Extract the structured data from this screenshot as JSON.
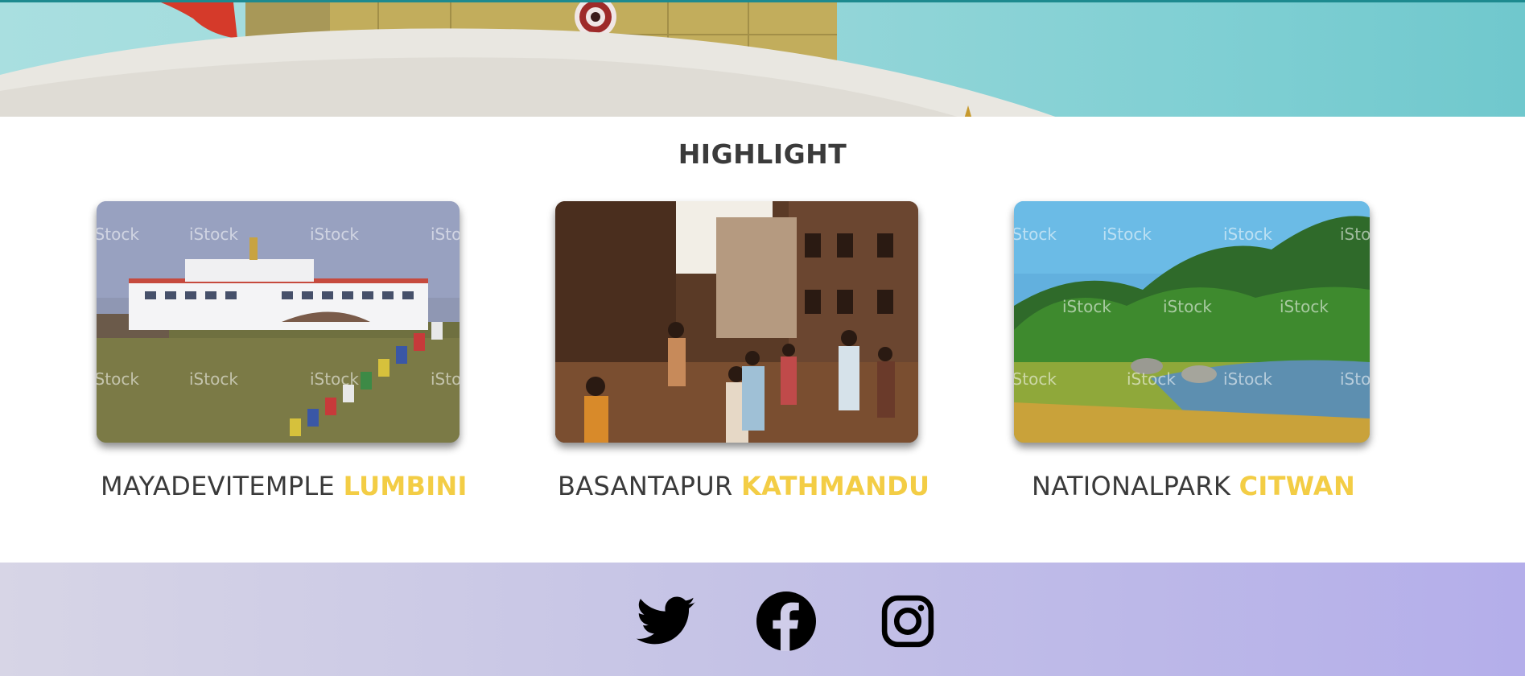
{
  "highlight": {
    "title": "HIGHLIGHT",
    "cards": [
      {
        "name": "MAYADEVITEMPLE",
        "place": "LUMBINI",
        "image": "mayadevi-temple-photo"
      },
      {
        "name": "BASANTAPUR",
        "place": "KATHMANDU",
        "image": "basantapur-square-photo"
      },
      {
        "name": "NATIONALPARK",
        "place": "CITWAN",
        "image": "national-park-rhino-photo"
      }
    ],
    "watermark": "iStock"
  },
  "social": {
    "items": [
      {
        "name": "twitter",
        "icon": "twitter-icon"
      },
      {
        "name": "facebook",
        "icon": "facebook-icon"
      },
      {
        "name": "instagram",
        "icon": "instagram-icon"
      }
    ]
  },
  "colors": {
    "accent": "#f3cd45",
    "text": "#3a3a3a",
    "hero_sky": "#9ad8da",
    "footer_start": "#d7d5e6",
    "footer_end": "#b4aeea"
  }
}
